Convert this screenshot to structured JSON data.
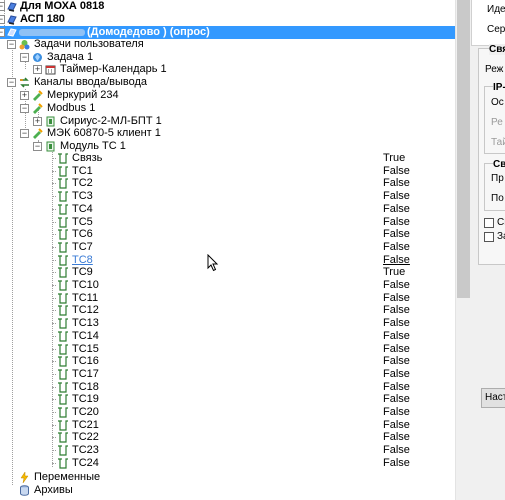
{
  "tree": {
    "top_nodes": [
      {
        "label": "Для МОХА 0818"
      },
      {
        "label": "АСП 180"
      }
    ],
    "selected_node": {
      "label_suffix": "(Домодедово ) (опрос)"
    },
    "user_tasks": {
      "label": "Задачи пользователя"
    },
    "task1": {
      "label": "Задача 1"
    },
    "timer": {
      "label": "Таймер-Календарь 1"
    },
    "io_channels": {
      "label": "Каналы ввода/вывода"
    },
    "mercury": {
      "label": "Меркурий 234"
    },
    "modbus": {
      "label": "Modbus 1"
    },
    "sirius": {
      "label": "Сириус-2-МЛ-БПТ 1"
    },
    "iec": {
      "label": "МЭК 60870-5 клиент 1"
    },
    "module": {
      "label": "Модуль ТС 1"
    },
    "signals": [
      {
        "name": "Связь",
        "value": "True"
      },
      {
        "name": "ТС1",
        "value": "False"
      },
      {
        "name": "ТС2",
        "value": "False"
      },
      {
        "name": "ТС3",
        "value": "False"
      },
      {
        "name": "ТС4",
        "value": "False"
      },
      {
        "name": "ТС5",
        "value": "False"
      },
      {
        "name": "ТС6",
        "value": "False"
      },
      {
        "name": "ТС7",
        "value": "False"
      },
      {
        "name": "ТС8",
        "value": "False"
      },
      {
        "name": "ТС9",
        "value": "True"
      },
      {
        "name": "ТС10",
        "value": "False"
      },
      {
        "name": "ТС11",
        "value": "False"
      },
      {
        "name": "ТС12",
        "value": "False"
      },
      {
        "name": "ТС13",
        "value": "False"
      },
      {
        "name": "ТС14",
        "value": "False"
      },
      {
        "name": "ТС15",
        "value": "False"
      },
      {
        "name": "ТС16",
        "value": "False"
      },
      {
        "name": "ТС17",
        "value": "False"
      },
      {
        "name": "ТС18",
        "value": "False"
      },
      {
        "name": "ТС19",
        "value": "False"
      },
      {
        "name": "ТС20",
        "value": "False"
      },
      {
        "name": "ТС21",
        "value": "False"
      },
      {
        "name": "ТС22",
        "value": "False"
      },
      {
        "name": "ТС23",
        "value": "False"
      },
      {
        "name": "ТС24",
        "value": "False"
      }
    ],
    "variables": {
      "label": "Переменные"
    },
    "archives": {
      "label": "Архивы"
    }
  },
  "right_panel": {
    "id_label": "Иде",
    "serial_label": "Сер",
    "group_link": "Свя",
    "mode_label": "Реж",
    "ip_group": "IP-",
    "ip_main": "Ос",
    "ip_reserve": "Ре",
    "ip_timeout": "Тай",
    "link_group": "Св",
    "link_check": "Пр",
    "link_after": "По",
    "check1_label": "Сп",
    "check2_label": "За",
    "settings_button": "Наст"
  },
  "colors": {
    "selection": "#3399ff",
    "link_hover": "#3a7bd5"
  }
}
